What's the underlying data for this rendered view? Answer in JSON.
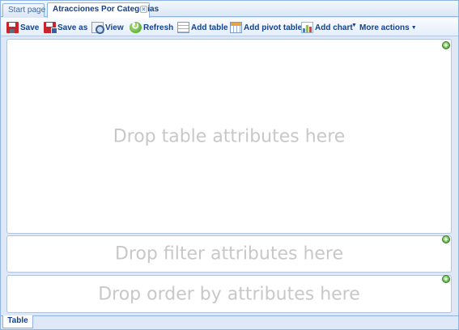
{
  "tabs": [
    {
      "label": "Start page",
      "active": false
    },
    {
      "label": "Atracciones Por Categorias",
      "active": true,
      "closable": true
    }
  ],
  "toolbar": {
    "save": "Save",
    "save_as": "Save as",
    "view": "View",
    "refresh": "Refresh",
    "add_table": "Add table",
    "add_pivot_table": "Add pivot table",
    "add_chart": "Add chart",
    "more_actions": "More actions"
  },
  "drop_zones": {
    "table": "Drop table attributes here",
    "filter": "Drop filter attributes here",
    "order": "Drop order by attributes here"
  },
  "bottom_tabs": [
    {
      "label": "Table",
      "active": true
    }
  ],
  "colors": {
    "accent": "#15428b",
    "border": "#8db2e3",
    "hint_text": "#c8c8c8",
    "add_green": "#3c9a2e",
    "save_red": "#c9242a"
  },
  "icons": {
    "save": "save-icon",
    "save_as": "save-as-icon",
    "view": "view-icon",
    "refresh": "refresh-icon",
    "add_table": "table-icon",
    "add_pivot_table": "pivot-table-icon",
    "add_chart": "chart-icon",
    "add_attribute": "add-icon",
    "close_tab": "close-icon"
  }
}
